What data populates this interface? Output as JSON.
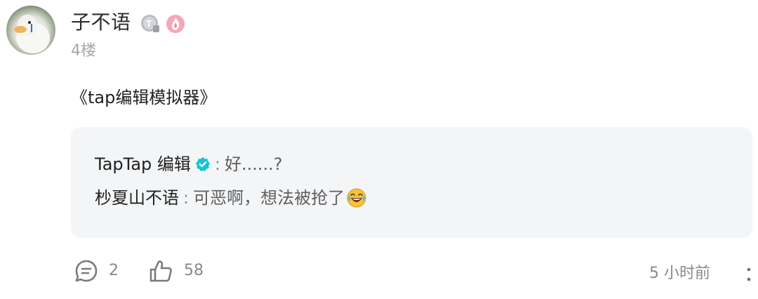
{
  "post": {
    "username": "子不语",
    "floor": "4楼",
    "content": "《tap编辑模拟器》",
    "badges": [
      "level-badge-icon",
      "flame-badge-icon"
    ]
  },
  "replies": [
    {
      "author": "TapTap 编辑",
      "verified": true,
      "separator": ":",
      "text": "好......?"
    },
    {
      "author": "杪夏山不语",
      "verified": false,
      "separator": ":",
      "text": "可恶啊，想法被抢了",
      "emoji": "laughing-crying-emoji"
    }
  ],
  "footer": {
    "comment_count": "2",
    "like_count": "58",
    "time": "5 小时前"
  },
  "colors": {
    "verified": "#12c6d6",
    "reply_bg": "#f4f5f7",
    "muted": "#8a8a8a"
  }
}
